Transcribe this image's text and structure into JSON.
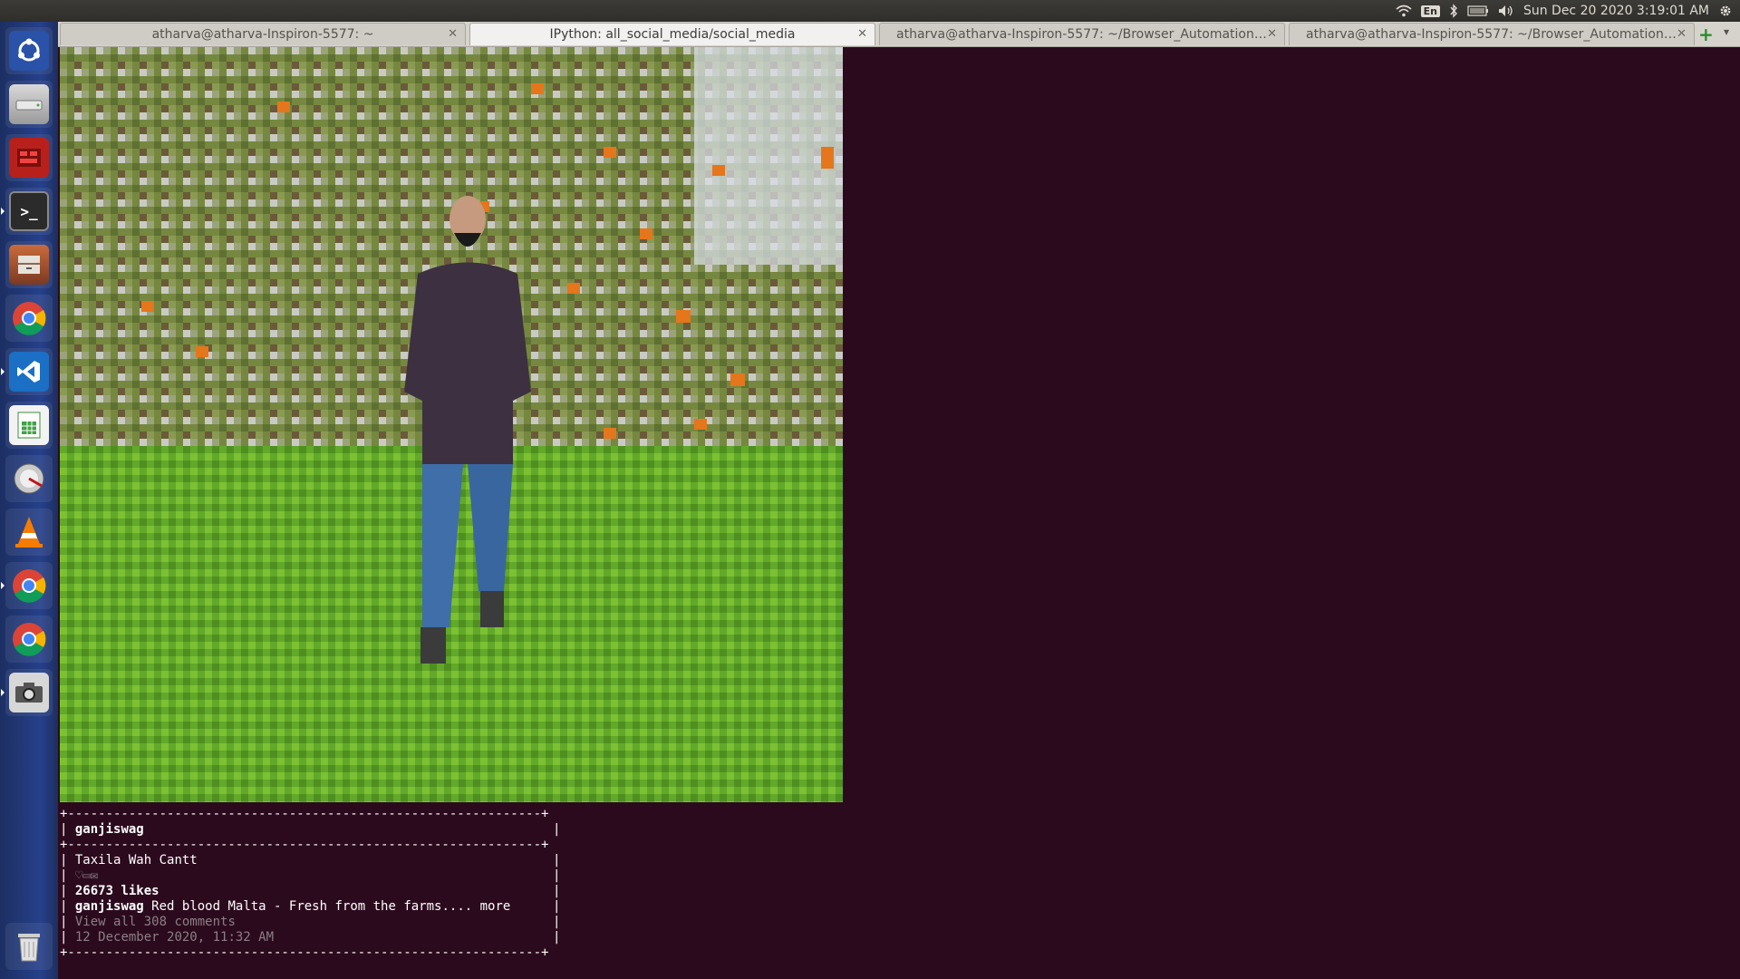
{
  "top_panel": {
    "language": "En",
    "clock": "Sun Dec 20 2020  3:19:01 AM"
  },
  "launcher": {
    "items": [
      {
        "name": "ubuntu-dash"
      },
      {
        "name": "files-drive"
      },
      {
        "name": "app-red"
      },
      {
        "name": "terminal"
      },
      {
        "name": "file-manager"
      },
      {
        "name": "chrome"
      },
      {
        "name": "vscode"
      },
      {
        "name": "spreadsheet"
      },
      {
        "name": "disk-tool"
      },
      {
        "name": "vlc"
      },
      {
        "name": "chrome-2"
      },
      {
        "name": "chrome-3"
      },
      {
        "name": "camera"
      },
      {
        "name": "trash"
      }
    ]
  },
  "tabs": [
    {
      "label": "atharva@atharva-Inspiron-5577: ~",
      "active": false
    },
    {
      "label": "IPython: all_social_media/social_media",
      "active": true
    },
    {
      "label": "atharva@atharva-Inspiron-5577: ~/Browser_Automation/...",
      "active": false
    },
    {
      "label": "atharva@atharva-Inspiron-5577: ~/Browser_Automation/...",
      "active": false
    }
  ],
  "post": {
    "username": "ganjiswag",
    "location": "Taxila Wah Cantt",
    "icons": "♡▭✉",
    "likes": "26673 likes",
    "caption_user": "ganjiswag",
    "caption_text": "Red blood Malta - Fresh from the farms.... more",
    "comments": "View all 308 comments",
    "date": "12 December 2020, 11:32 AM"
  },
  "box": {
    "border": "+--------------------------------------------------------------+",
    "bar": "|"
  }
}
